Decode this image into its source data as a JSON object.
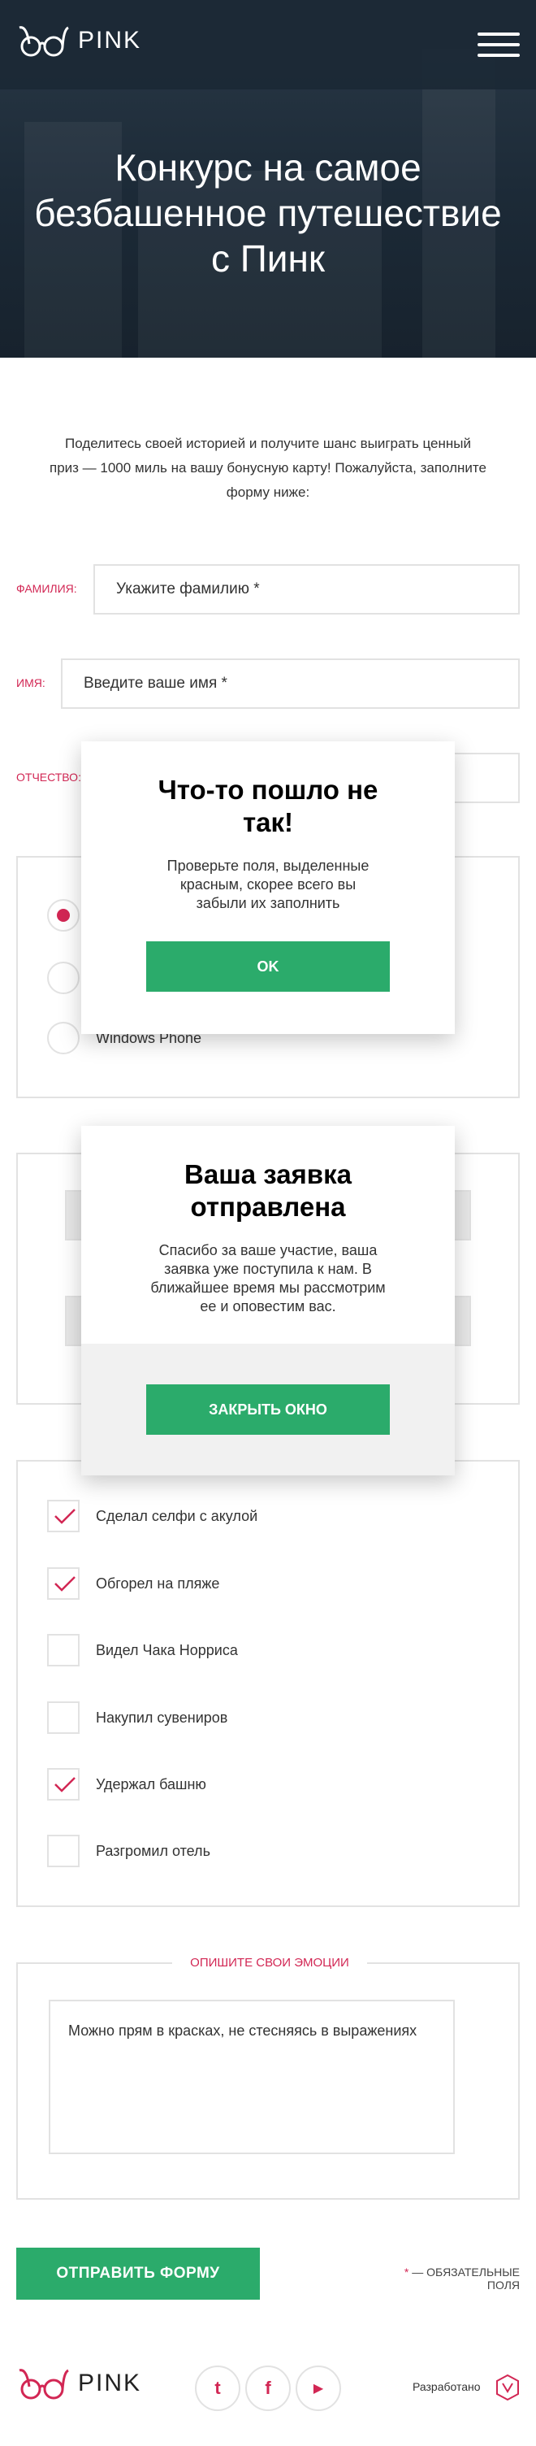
{
  "header": {
    "logo_text": "PINK",
    "title": "Конкурс на самое безбашенное путешествие с Пинк",
    "menu_icon": "hamburger-icon"
  },
  "intro_text": "Поделитесь своей историей и получите шанс выиграть ценный приз — 1000 миль на вашу бонусную карту! Пожалуйста, заполните форму ниже:",
  "fields": {
    "surname": {
      "label": "ФАМИЛИЯ:",
      "placeholder": "Укажите фамилию *"
    },
    "name": {
      "label": "ИМЯ:",
      "placeholder": "Введите ваше имя *"
    },
    "patronymic": {
      "label": "ОТЧЕСТВО:",
      "placeholder": ""
    }
  },
  "os_options": {
    "visible_label": "Windows Phone",
    "selected_index": 0
  },
  "checkboxes": [
    {
      "label": "Сделал селфи с акулой",
      "checked": true
    },
    {
      "label": "Обгорел на пляже",
      "checked": true
    },
    {
      "label": "Видел Чака Норриса",
      "checked": false
    },
    {
      "label": "Накупил сувениров",
      "checked": false
    },
    {
      "label": "Удержал башню",
      "checked": true
    },
    {
      "label": "Разгромил отель",
      "checked": false
    }
  ],
  "emotions": {
    "legend": "ОПИШИТЕ СВОИ ЭМОЦИИ",
    "placeholder": "Можно прям в красках, не стесняясь в выражениях"
  },
  "submit_label": "ОТПРАВИТЬ ФОРМУ",
  "required_note": {
    "star": "*",
    "text": " — ОБЯЗАТЕЛЬНЫЕ ПОЛЯ"
  },
  "footer": {
    "logo_text": "PINK",
    "social": [
      {
        "icon": "twitter-icon",
        "glyph": "t"
      },
      {
        "icon": "facebook-icon",
        "glyph": "f"
      },
      {
        "icon": "youtube-icon",
        "glyph": "▶"
      }
    ],
    "dev_label": "Разработано"
  },
  "error_modal": {
    "title": "Что-то пошло не так!",
    "text": "Проверьте поля, выделенные красным, скорее всего вы забыли их заполнить",
    "button": "OK"
  },
  "success_modal": {
    "title": "Ваша заявка отправлена",
    "text": "Спасибо за ваше участие, ваша заявка уже поступила к нам. В ближайшее время мы рассмотрим ее и оповестим вас.",
    "button": "ЗАКРЫТЬ ОКНО"
  },
  "colors": {
    "accent": "#d22754",
    "green": "#2bab6b",
    "header": "#1b2835",
    "border": "#e2e2e2"
  }
}
